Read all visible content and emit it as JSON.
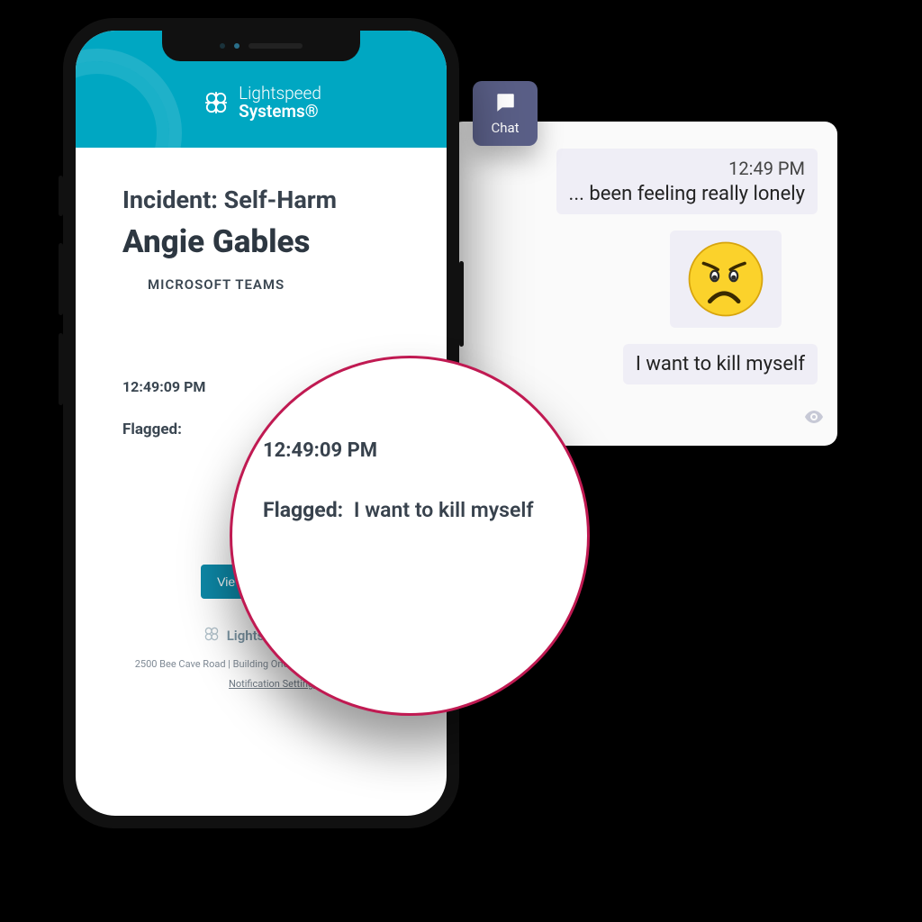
{
  "brand": {
    "line1": "Lightspeed",
    "line2": "Systems®",
    "footer_name": "Lightspeed Systems"
  },
  "incident": {
    "label": "Incident: Self-Harm",
    "person": "Angie Gables",
    "source": "MICROSOFT TEAMS",
    "timestamp": "12:49:09 PM",
    "flag_label": "Flagged:",
    "flag_text": "I want to kill myself"
  },
  "cta": {
    "view_activity": "View Student Activity"
  },
  "footer": {
    "address": "2500 Bee Cave Road | Building One, Suite 350 | Austin, TX 78746",
    "notif_link": "Notification Settings"
  },
  "magnifier": {
    "timestamp": "12:49:09 PM",
    "flag_label": "Flagged:",
    "flag_text": "I want to kill myself"
  },
  "chat": {
    "tab_label": "Chat",
    "msg1_time": "12:49 PM",
    "msg1_text": "... been feeling really lonely",
    "msg3_text": "I want to kill myself"
  },
  "colors": {
    "teal": "#00a7c2",
    "teal_btn": "#0d89a8",
    "magnifier_ring": "#c01a52",
    "chat_tab": "#5a5f87",
    "bubble": "#efeef6"
  }
}
